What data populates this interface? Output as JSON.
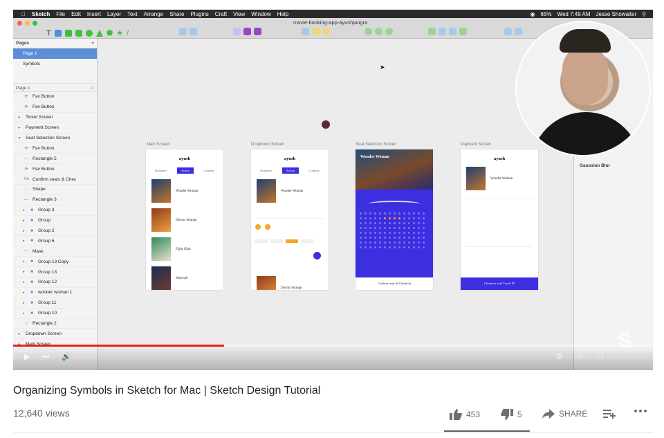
{
  "menubar": {
    "app_name": "Sketch",
    "items": [
      "File",
      "Edit",
      "Insert",
      "Layer",
      "Text",
      "Arrange",
      "Share",
      "Plugins",
      "Craft",
      "View",
      "Window",
      "Help"
    ],
    "battery": "65%",
    "clock": "Wed 7:49 AM",
    "user": "Jesse Showalter"
  },
  "toolbar": {
    "document_title": "movie-booking-app-ayushjangra"
  },
  "sidebar": {
    "pages_header": "Pages",
    "add_symbol": "+",
    "pages": [
      "Page 1",
      "Symbols"
    ],
    "layers_header": "Page 1",
    "layers": [
      {
        "label": "Fav Button",
        "depth": 1,
        "icon": "symbol-icon"
      },
      {
        "label": "Fav Button",
        "depth": 1,
        "icon": "symbol-icon"
      },
      {
        "label": "Ticket Screen",
        "depth": 0,
        "icon": "disclosure-arrow-icon"
      },
      {
        "label": "Payment Screen",
        "depth": 0,
        "icon": "disclosure-arrow-icon"
      },
      {
        "label": "Seat Selection Screen",
        "depth": 0,
        "icon": "disclosure-open-icon"
      },
      {
        "label": "Fav Button",
        "depth": 1,
        "icon": "symbol-icon"
      },
      {
        "label": "Rectangle 5",
        "depth": 1,
        "icon": "line-icon"
      },
      {
        "label": "Fav Button",
        "depth": 1,
        "icon": "symbol-icon"
      },
      {
        "label": "Confirm seats & Chec",
        "depth": 1,
        "icon": "text-icon"
      },
      {
        "label": "Shape",
        "depth": 1,
        "icon": "arrow-icon"
      },
      {
        "label": "Rectangle 3",
        "depth": 1,
        "icon": "line-icon"
      },
      {
        "label": "Group 3",
        "depth": 1,
        "icon": "folder-icon"
      },
      {
        "label": "Group",
        "depth": 1,
        "icon": "folder-icon"
      },
      {
        "label": "Group 2",
        "depth": 1,
        "icon": "folder-icon"
      },
      {
        "label": "Group 6",
        "depth": 1,
        "icon": "folder-icon"
      },
      {
        "label": "Mask",
        "depth": 1,
        "icon": "line-icon"
      },
      {
        "label": "Group 13 Copy",
        "depth": 1,
        "icon": "folder-icon"
      },
      {
        "label": "Group 13",
        "depth": 1,
        "icon": "folder-icon"
      },
      {
        "label": "Group 12",
        "depth": 1,
        "icon": "folder-icon"
      },
      {
        "label": "wonder woman 1",
        "depth": 1,
        "icon": "folder-icon"
      },
      {
        "label": "Group 11",
        "depth": 1,
        "icon": "folder-icon"
      },
      {
        "label": "Group 10",
        "depth": 1,
        "icon": "folder-icon"
      },
      {
        "label": "Rectangle 2",
        "depth": 1,
        "icon": "rectangle-icon"
      },
      {
        "label": "Dropdown Screen",
        "depth": 0,
        "icon": "disclosure-arrow-icon"
      },
      {
        "label": "Main Screen",
        "depth": 0,
        "icon": "disclosure-arrow-icon"
      }
    ]
  },
  "canvas": {
    "artboards": [
      {
        "label": "Main Screen"
      },
      {
        "label": "Dropdown Screen"
      },
      {
        "label": "Seat Selection Screen"
      },
      {
        "label": "Payment Screen"
      }
    ],
    "app_logo": "ayush",
    "tabs": [
      "Romance",
      "Action",
      "Comedy"
    ],
    "movies": [
      {
        "title": "Wonder Woman"
      },
      {
        "title": "Doctor Strange"
      },
      {
        "title": "Fight Club"
      },
      {
        "title": "Warcraft"
      }
    ],
    "seat_screen_title": "Wonder Woman",
    "seat_confirm": "Confirm seats & Checkout",
    "pay_button": "Checkout with Touch ID"
  },
  "inspector": {
    "gaussian_blur": "Gaussian Blur"
  },
  "video": {
    "progress": 0.33
  },
  "meta": {
    "title": "Organizing Symbols in Sketch for Mac | Sketch Design Tutorial",
    "views": "12,640 views",
    "likes": "453",
    "dislikes": "5",
    "share_label": "SHARE",
    "like_ratio": 0.989
  },
  "colors": {
    "accent": "#3c2fe0",
    "selection": "#5b8ed6",
    "progress": "#e62117"
  }
}
